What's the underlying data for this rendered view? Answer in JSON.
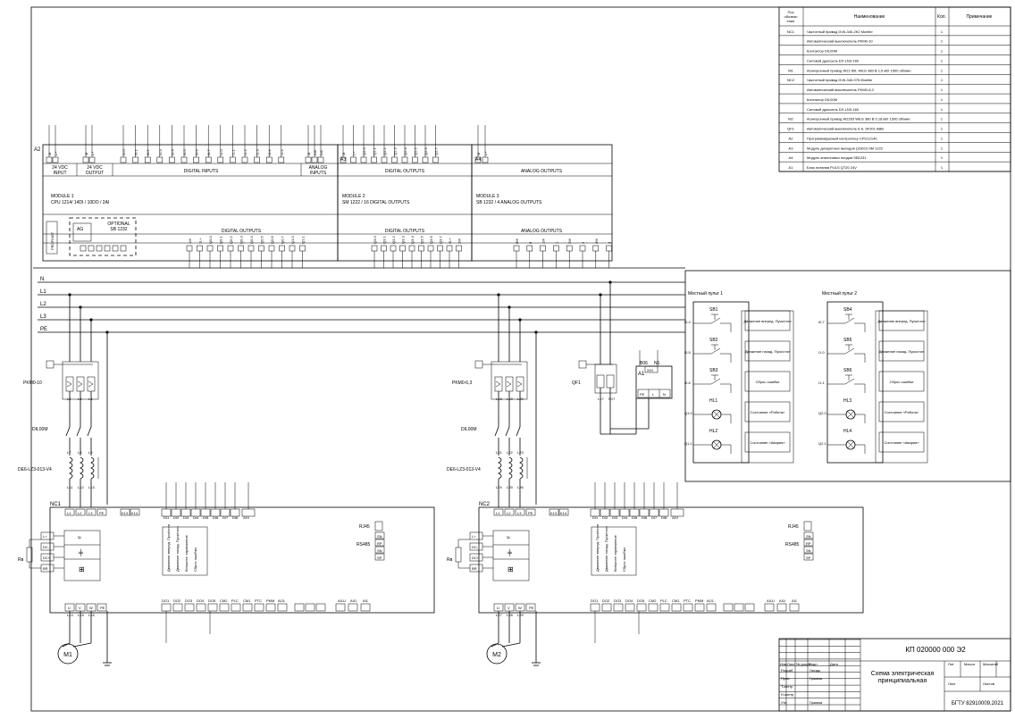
{
  "spec_table": {
    "headers": [
      "Поз обознач ение",
      "Наименование",
      "Кол.",
      "Примечание"
    ],
    "rows": [
      [
        "NC1",
        "Частотный привод DV6-340-2K2 Moeller",
        "1",
        ""
      ],
      [
        "",
        "Автоматический выключатель PKM0-10",
        "1",
        ""
      ],
      [
        "",
        "Контактор DIL00M",
        "1",
        ""
      ],
      [
        "",
        "Силовой дроссель DX-LN3-160",
        "1",
        ""
      ],
      [
        "M1",
        "Асинхронный привод W22 80L WEG 380 В 1,5 кВт 1500 об/мин",
        "1",
        ""
      ],
      [
        "NC2",
        "Частотный привод DV6-340-075 Moeller",
        "1",
        ""
      ],
      [
        "",
        "Автоматический выключатель PKM0-6,3",
        "1",
        ""
      ],
      [
        "",
        "Контактор DIL00M",
        "1",
        ""
      ],
      [
        "",
        "Силовой дроссель DX-LN3-160",
        "1",
        ""
      ],
      [
        "M2",
        "Асинхронный привод W2263 WEG 380 В 0,18 кВт 1500 об/мин",
        "1",
        ""
      ],
      [
        "QF1",
        "Автоматический выключатель 6 А, SF201 ABB",
        "1",
        ""
      ],
      [
        "A2",
        "Программируемый контроллер CPU1214C",
        "1",
        ""
      ],
      [
        "A3",
        "Модуль дискретных выходов (16DO) SM 1222",
        "1",
        ""
      ],
      [
        "A4",
        "Модуль аналоговых входов SB1231",
        "1",
        ""
      ],
      [
        "A1",
        "Блок питания PULS QT20 24V",
        "1",
        ""
      ]
    ]
  },
  "plc": {
    "tag": "A2",
    "m1_top_pins": [
      "I0.0",
      "I0.1",
      "I0.2",
      "I0.3",
      "I0.4",
      "I0.5",
      "I0.6",
      "I0.7",
      "I1.0",
      "I1.1",
      "I1.2",
      "I1.3",
      "I1.4",
      "I1.5"
    ],
    "m1_sections": [
      "24 VDC INPUT",
      "24 VDC OUTPUT",
      "DIGITAL INPUTS",
      "ANALOG INPUTS"
    ],
    "m1_name": "MODULE 1",
    "m1_desc": "CPU 1214/ 14DI / 10DO / 2AI",
    "m2_tag": "A3",
    "m2_sections": [
      "DIGITAL OUTPUTS"
    ],
    "m2_name": "MODULE 2",
    "m2_desc": "SM 1222 / 16 DIGITAL OUTPUTS",
    "m3_tag": "A4",
    "m3_sections": [
      "ANALOG OUTPUTS"
    ],
    "m3_name": "MODULE 3",
    "m3_desc": "SB 1232 / 4 ANALOG OUTPUTS",
    "m2_top_pins": [
      "Q2.0",
      "Q2.1",
      "Q2.2",
      "Q2.3",
      "Q2.4",
      "Q2.5",
      "Q2.6",
      "Q2.7"
    ],
    "ai_pins": [
      "AI0",
      "AI1"
    ],
    "profinet": "PROFINET",
    "ag": "AG",
    "optional": "OPTIONAL",
    "optional_sb": "SB 1232",
    "bottom_label_do": "DIGITAL OUTPUTS",
    "bottom_label_ao": "ANALOG OUTPUTS",
    "q_pins_bottom": [
      "Q0.0",
      "Q0.1",
      "Q0.2",
      "Q0.3",
      "Q0.4",
      "Q0.5",
      "Q0.6",
      "Q0.7",
      "Q1.0",
      "Q1.1"
    ],
    "q2_pins_bottom": [
      "Q3.0",
      "Q3.1",
      "Q3.2",
      "Q3.3",
      "Q3.4",
      "Q3.5",
      "Q3.6",
      "Q3.7"
    ],
    "ao_pins": [
      "0M",
      "0",
      "1M",
      "1",
      "2M",
      "2",
      "3M",
      "3"
    ]
  },
  "buses": [
    "N",
    "L1",
    "L2",
    "L3",
    "PE"
  ],
  "drive1": {
    "breaker": "PKM0-10",
    "contactor": "DIL00M",
    "choke": "DE6-LZ3-013-V4",
    "drive": "NC1",
    "motor": "M1",
    "l_top": [
      "L4",
      "L5",
      "L6"
    ],
    "l_mid": [
      "L7",
      "L8",
      "L9"
    ],
    "l_low": [
      "L11",
      "L12",
      "L13"
    ],
    "l_out": [
      "L14",
      "L15",
      "L16"
    ],
    "in_pins": [
      "L1",
      "L2",
      "L3",
      "PE"
    ],
    "out_pins": [
      "U",
      "V",
      "W",
      "PE"
    ],
    "k_pins": [
      "K13",
      "K14"
    ],
    "dc_pins": [
      "L+",
      "DC-",
      "DC+",
      "BR"
    ],
    "di_pins": [
      "DI1",
      "DI2",
      "DI3",
      "DI4",
      "DI5",
      "DI6",
      "DI7",
      "DI8"
    ],
    "di_funcs": [
      "Движение вперед. Пуск/стоп",
      "Движение назад. Пуск/стоп",
      "Внешнее торможение",
      "Сброс ошибки"
    ],
    "bottom_pins": [
      "DO1",
      "DO2",
      "DO3",
      "DO4",
      "DO5",
      "CM2",
      "PLC",
      "CM1",
      "PTC",
      "PMM",
      "AO1"
    ],
    "rj": "RJ45",
    "rs": "RS485",
    "v24": "24V",
    "rs_pins": [
      "SN",
      "RP",
      "SN",
      "SP"
    ],
    "ai_labels": [
      "AI1U",
      "AI1I",
      "AI1"
    ],
    "r_label": "Rв"
  },
  "drive2": {
    "breaker": "PKM0-6,3",
    "contactor": "DIL00M",
    "choke": "DE6-LZ3-013-V4",
    "drive": "NC2",
    "motor": "M2",
    "qf": "QF1",
    "l_top": [
      "L18",
      "L19",
      "L20"
    ],
    "l_mid": [
      "L21",
      "L22",
      "L23"
    ],
    "l_low": [
      "L24",
      "L25",
      "L26"
    ],
    "l_out": [
      "L27",
      "L28",
      "L29"
    ],
    "l_qf": [
      "L17",
      "N17"
    ],
    "in_pins": [
      "L1",
      "L2",
      "L3",
      "PE"
    ],
    "out_pins": [
      "U",
      "V",
      "W",
      "PE"
    ],
    "k_pins": [
      "K13",
      "K14"
    ],
    "dc_pins": [
      "L+",
      "DC-",
      "DC+",
      "BR"
    ],
    "di_pins": [
      "DI1",
      "DI2",
      "DI3",
      "DI4",
      "DI5",
      "DI6",
      "DI7",
      "DI8"
    ],
    "di_funcs": [
      "Движение вперед. Пуск/стоп",
      "Движение назад. Пуск/стоп",
      "Внешнее торможение",
      "Сброс ошибки"
    ],
    "bottom_pins": [
      "DO1",
      "DO2",
      "DO3",
      "DO4",
      "DO5",
      "CM2",
      "PLC",
      "CM1",
      "PTC",
      "PMM",
      "AO1"
    ],
    "rj": "RJ45",
    "rs": "RS485",
    "v24": "24V",
    "rs_pins": [
      "SN",
      "RP",
      "SN",
      "SP"
    ],
    "ai_labels": [
      "AI1U",
      "AI1I",
      "AI1"
    ],
    "r_label": "Rв"
  },
  "psu": {
    "tag": "A1",
    "pins_top": [
      "B06",
      "N1"
    ],
    "v": "24V",
    "pins_bot": [
      "PE",
      "L",
      "N"
    ]
  },
  "panel1": {
    "title": "Местный пульт 1",
    "items": [
      {
        "tag": "SB1",
        "io": "I0.4",
        "desc": "Движение вперед. Пуск/стоп"
      },
      {
        "tag": "SB2",
        "io": "I0.5",
        "desc": "Движение назад. Пуск/стоп"
      },
      {
        "tag": "SB3",
        "io": "I0.6",
        "desc": "Сброс ошибки"
      },
      {
        "tag": "HL1",
        "io": "Q1.0",
        "desc": "Состояние «Работа»"
      },
      {
        "tag": "HL2",
        "io": "Q1.1",
        "desc": "Состояние «Авария»"
      }
    ]
  },
  "panel2": {
    "title": "Местный пульт 2",
    "items": [
      {
        "tag": "SB4",
        "io": "I0.7",
        "desc": "Движение вперед. Пуск/стоп"
      },
      {
        "tag": "SB5",
        "io": "I1.0",
        "desc": "Движение назад. Пуск/стоп"
      },
      {
        "tag": "SB6",
        "io": "I1.1",
        "desc": "Сброс ошибки"
      },
      {
        "tag": "HL3",
        "io": "Q2.0",
        "desc": "Состояние «Работа»"
      },
      {
        "tag": "HL4",
        "io": "Q2.1",
        "desc": "Состояние «Авария»"
      }
    ]
  },
  "title_block": {
    "code": "КП 020000 000 Э2",
    "title1": "Схема электрическая",
    "title2": "принципиальная",
    "org": "БГТУ 82910009,2021",
    "lit": "Лит",
    "mass": "Масса",
    "scale": "Масштаб",
    "sheet": "Лист",
    "sheets": "Листов",
    "rows_left": [
      "Изм",
      "Лист",
      "№ докум",
      "Подп",
      "Дата"
    ],
    "roles": [
      "Разраб",
      "Пров",
      "Т.контр",
      "Н.контр",
      "Утв"
    ],
    "names": [
      "Гвоздь",
      "Грамма",
      "",
      "",
      "Грамма"
    ]
  }
}
